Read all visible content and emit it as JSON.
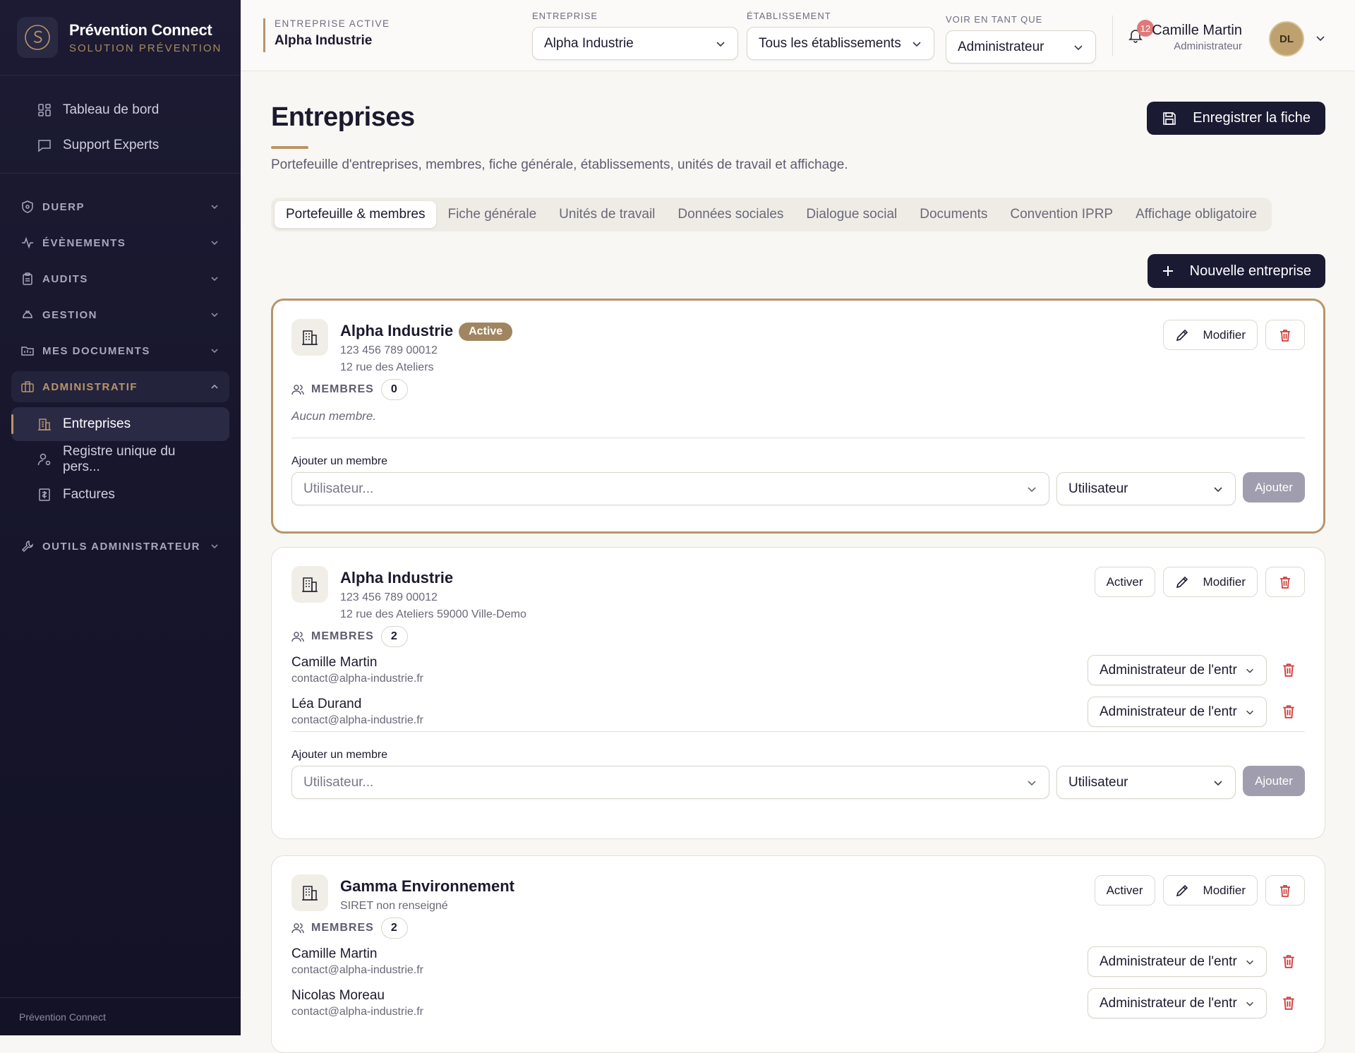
{
  "brand": {
    "title": "Prévention Connect",
    "subtitle": "SOLUTION PRÉVENTION"
  },
  "sidebar": {
    "top_items": [
      {
        "label": "Tableau de bord",
        "icon": "dashboard-icon"
      },
      {
        "label": "Support Experts",
        "icon": "chat-icon"
      }
    ],
    "sections": [
      {
        "label": "DUERP",
        "icon": "shield-icon"
      },
      {
        "label": "ÉVÈNEMENTS",
        "icon": "activity-icon"
      },
      {
        "label": "AUDITS",
        "icon": "clipboard-icon"
      },
      {
        "label": "GESTION",
        "icon": "helmet-icon"
      },
      {
        "label": "MES DOCUMENTS",
        "icon": "folder-icon"
      },
      {
        "label": "ADMINISTRATIF",
        "icon": "briefcase-icon"
      },
      {
        "label": "OUTILS ADMINISTRATEUR",
        "icon": "wrench-icon"
      }
    ],
    "admin_items": [
      {
        "label": "Entreprises",
        "icon": "building-icon"
      },
      {
        "label": "Registre unique du pers...",
        "icon": "user-cog-icon"
      },
      {
        "label": "Factures",
        "icon": "invoice-icon"
      }
    ],
    "footer": "Prévention Connect"
  },
  "topbar": {
    "active_company_label": "ENTREPRISE ACTIVE",
    "active_company": "Alpha Industrie",
    "entreprise_label": "ENTREPRISE",
    "entreprise_value": "Alpha Industrie",
    "etablissement_label": "ÉTABLISSEMENT",
    "etablissement_value": "Tous les établissements",
    "voir_label": "VOIR EN TANT QUE",
    "voir_value": "Administrateur",
    "notifications": "12",
    "user_name": "Camille Martin",
    "user_role": "Administrateur",
    "avatar_initials": "DL"
  },
  "page": {
    "title": "Entreprises",
    "description": "Portefeuille d'entreprises, membres, fiche générale, établissements, unités de travail et affichage.",
    "save_label": "Enregistrer la fiche",
    "new_label": "Nouvelle entreprise",
    "tabs": [
      "Portefeuille & membres",
      "Fiche générale",
      "Unités de travail",
      "Données sociales",
      "Dialogue social",
      "Documents",
      "Convention IPRP",
      "Affichage obligatoire"
    ]
  },
  "labels": {
    "members": "MEMBRES",
    "add_member": "Ajouter un membre",
    "user_placeholder": "Utilisateur...",
    "role_default": "Utilisateur",
    "add_button": "Ajouter",
    "edit_button": "Modifier",
    "activate_button": "Activer",
    "no_members": "Aucun membre.",
    "member_role": "Administrateur de l'entr"
  },
  "companies": [
    {
      "name": "Alpha Industrie",
      "badge": "Active",
      "siret": "123 456 789 00012",
      "address": "12 rue des Ateliers",
      "count": "0",
      "members": []
    },
    {
      "name": "Alpha Industrie",
      "siret": "123 456 789 00012",
      "address": "12 rue des Ateliers 59000 Ville-Demo",
      "count": "2",
      "members": [
        {
          "name": "Camille Martin",
          "email": "contact@alpha-industrie.fr"
        },
        {
          "name": "Léa Durand",
          "email": "contact@alpha-industrie.fr"
        }
      ]
    },
    {
      "name": "Gamma Environnement",
      "siret": "SIRET non renseigné",
      "count": "2",
      "members": [
        {
          "name": "Camille Martin",
          "email": "contact@alpha-industrie.fr"
        },
        {
          "name": "Nicolas Moreau",
          "email": "contact@alpha-industrie.fr"
        }
      ]
    }
  ],
  "colors": {
    "sidebar_bg": "#1c1b33",
    "accent": "#b8956a",
    "primary_button": "#1b1a33",
    "danger": "#d33b3b",
    "badge": "#e07a7a"
  }
}
